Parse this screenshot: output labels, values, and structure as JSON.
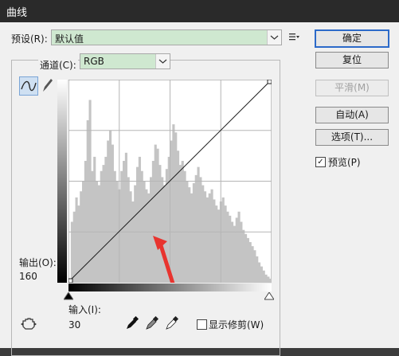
{
  "window": {
    "title": "曲线"
  },
  "preset": {
    "label": "预设(R):",
    "value": "默认值"
  },
  "channel": {
    "label": "通道(C):",
    "value": "RGB"
  },
  "curve": {
    "output_label": "输出(O):",
    "output_value": "160",
    "input_label": "输入(I):",
    "input_value": "30",
    "line_color": "#1a1a1a",
    "histogram_color": "#c4c4c4",
    "arrow_color": "#e8342f",
    "histogram_levels": [
      0.02,
      0.3,
      0.35,
      0.42,
      0.38,
      0.45,
      0.5,
      0.6,
      0.8,
      0.9,
      0.55,
      0.62,
      0.5,
      0.48,
      0.55,
      0.58,
      0.62,
      0.7,
      0.75,
      0.68,
      0.55,
      0.5,
      0.46,
      0.55,
      0.6,
      0.64,
      0.52,
      0.45,
      0.4,
      0.48,
      0.57,
      0.62,
      0.55,
      0.5,
      0.46,
      0.44,
      0.52,
      0.6,
      0.68,
      0.66,
      0.58,
      0.52,
      0.48,
      0.56,
      0.62,
      0.7,
      0.78,
      0.74,
      0.65,
      0.58,
      0.6,
      0.55,
      0.5,
      0.47,
      0.44,
      0.49,
      0.53,
      0.57,
      0.52,
      0.48,
      0.45,
      0.42,
      0.44,
      0.46,
      0.41,
      0.38,
      0.36,
      0.4,
      0.42,
      0.38,
      0.35,
      0.33,
      0.3,
      0.28,
      0.32,
      0.35,
      0.3,
      0.26,
      0.24,
      0.22,
      0.2,
      0.18,
      0.16,
      0.13,
      0.1,
      0.08,
      0.06,
      0.04,
      0.03,
      0.02
    ]
  },
  "buttons": {
    "ok": "确定",
    "reset": "复位",
    "smooth": "平滑(M)",
    "auto": "自动(A)",
    "options": "选项(T)..."
  },
  "preview": {
    "label": "预览(P)",
    "checked": true,
    "mark": "✓"
  },
  "show_clipping": {
    "label": "显示修剪(W)",
    "checked": false
  },
  "icons": [
    "preset-menu-icon",
    "curve-tool-icon",
    "pencil-icon",
    "eyedropper-black-icon",
    "eyedropper-gray-icon",
    "eyedropper-white-icon",
    "hand-adjust-icon",
    "black-point-slider-icon",
    "white-point-slider-icon",
    "chevron-down-icon"
  ]
}
